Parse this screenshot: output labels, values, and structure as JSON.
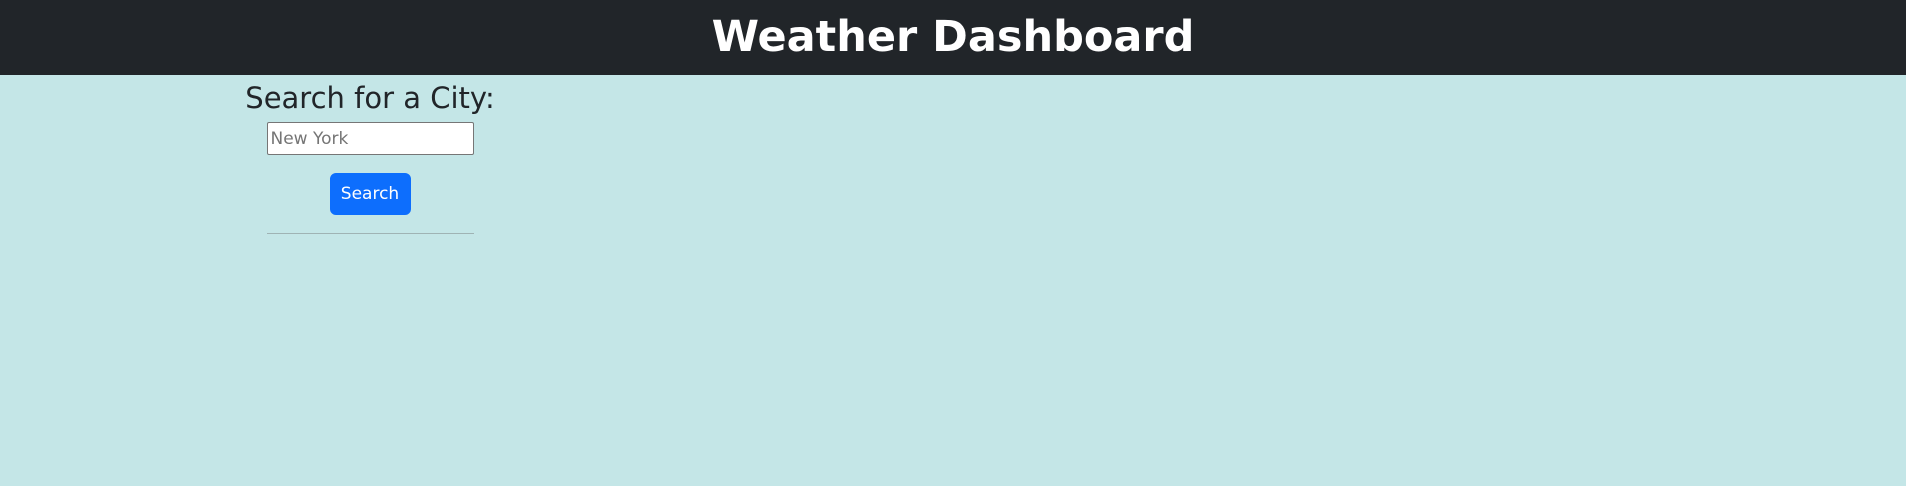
{
  "header": {
    "title": "Weather Dashboard"
  },
  "search": {
    "heading": "Search for a City:",
    "placeholder": "New York",
    "value": "",
    "button_label": "Search"
  },
  "colors": {
    "header_bg": "#212529",
    "page_bg": "#c4e6e7",
    "button_bg": "#0d6efd"
  }
}
